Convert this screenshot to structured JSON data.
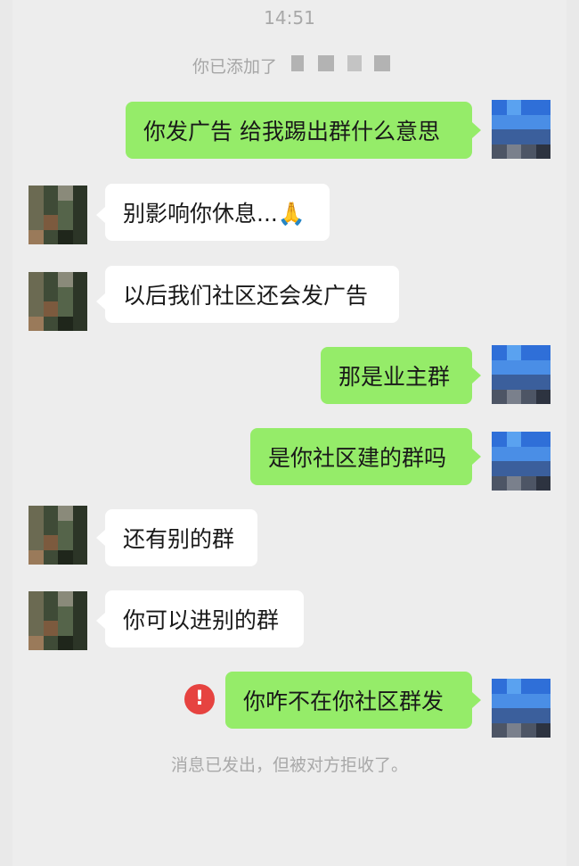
{
  "status": {
    "time": "14:51"
  },
  "system": {
    "added_note": "你已添加了"
  },
  "messages": [
    {
      "from": "me",
      "text": "你发广告 给我踢出群什么意思"
    },
    {
      "from": "other",
      "text": "别影响你休息...🙏"
    },
    {
      "from": "other",
      "text": "以后我们社区还会发广告"
    },
    {
      "from": "me",
      "text": "那是业主群"
    },
    {
      "from": "me",
      "text": "是你社区建的群吗"
    },
    {
      "from": "other",
      "text": "还有别的群"
    },
    {
      "from": "other",
      "text": "你可以进别的群"
    },
    {
      "from": "me",
      "text": "你咋不在你社区群发",
      "failed": true
    }
  ],
  "error": {
    "icon": "!",
    "icon_name": "error-icon"
  },
  "footer": {
    "rejected_note": "消息已发出，但被对方拒收了。"
  },
  "colors": {
    "background": "#ededed",
    "bubble_out": "#95ec69",
    "bubble_in": "#ffffff",
    "error": "#e64340",
    "system_text": "#a6a6a6"
  }
}
